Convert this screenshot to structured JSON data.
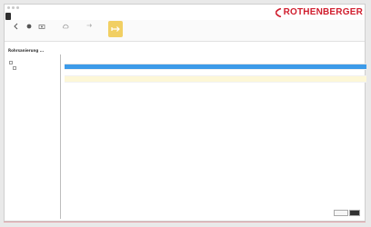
{
  "brand": {
    "name": "ROTHENBERGER",
    "color": "#d01e2e"
  },
  "ribbon": {
    "tabs": [
      {
        "label": "",
        "active": true
      },
      {
        "label": "",
        "active": false
      },
      {
        "label": "",
        "active": false
      }
    ]
  },
  "toolbar": {
    "buttons": [
      {
        "icon": "back-icon",
        "label": ""
      },
      {
        "icon": "record-icon",
        "label": ""
      },
      {
        "icon": "camera-icon",
        "label": ""
      },
      {
        "icon": "cloud-icon",
        "label": ""
      },
      {
        "icon": "export-icon",
        "label": ""
      },
      {
        "icon": "sync-icon",
        "label": ""
      }
    ],
    "highlight_color": "#f1cf63"
  },
  "path": "Rohrsanierung ...",
  "sidebar": {
    "tools": [
      "",
      "",
      ""
    ],
    "items": [
      {
        "label": ""
      },
      {
        "label": ""
      }
    ]
  },
  "table": {
    "columns": [
      "",
      "",
      "",
      "",
      "",
      "",
      "",
      "",
      "",
      ""
    ],
    "rows": [
      {
        "style": "blue",
        "cells": [
          "",
          "",
          "",
          "",
          "",
          "",
          "",
          "",
          "",
          ""
        ]
      },
      {
        "style": "normal",
        "cells": [
          "",
          "",
          "",
          "",
          "",
          "",
          "",
          "",
          "",
          ""
        ]
      },
      {
        "style": "yellow",
        "cells": [
          "",
          "",
          "",
          "",
          "",
          "",
          "",
          "",
          "",
          ""
        ]
      }
    ],
    "selected_color": "#3d9be9",
    "highlight_color": "#fdf7d7"
  },
  "pager": {
    "items": [
      "",
      ""
    ]
  }
}
